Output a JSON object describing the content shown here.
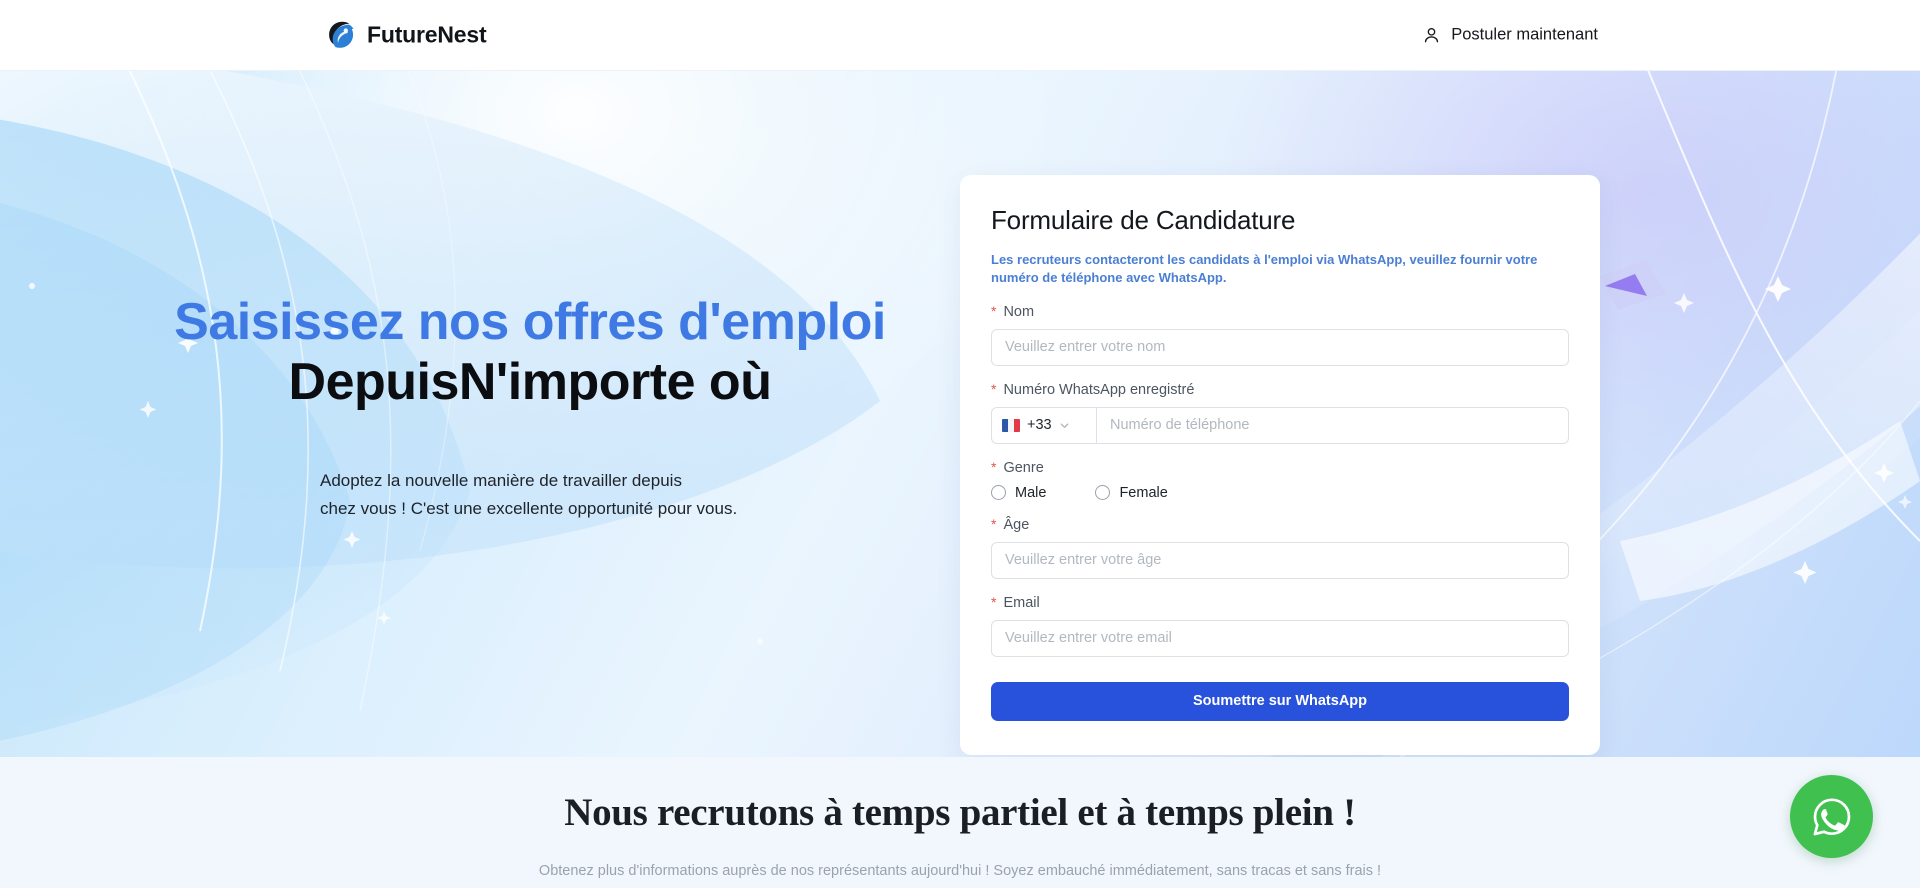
{
  "header": {
    "brand_name": "FutureNest",
    "logo_icon": "leaf-swirl-logo",
    "cta_icon": "user-icon",
    "cta_label": "Postuler maintenant"
  },
  "hero": {
    "headline_blue": "Saisissez nos offres d'emploi",
    "headline_dark": "DepuisN'importe où",
    "sub_line1": "Adoptez la nouvelle manière de travailler depuis",
    "sub_line2": "chez vous ! C'est une excellente opportunité pour vous."
  },
  "form": {
    "title": "Formulaire de Candidature",
    "notice": "Les recruteurs contacteront les candidats à l'emploi via WhatsApp, veuillez fournir votre numéro de téléphone avec WhatsApp.",
    "required_marker": "*",
    "name": {
      "label": "Nom",
      "value": "",
      "placeholder": "Veuillez entrer votre nom"
    },
    "whatsapp": {
      "label": "Numéro WhatsApp enregistré",
      "country_flag": "flag-france",
      "dial_code": "+33",
      "chevron_icon": "chevron-down-icon",
      "value": "",
      "placeholder": "Numéro de téléphone"
    },
    "gender": {
      "label": "Genre",
      "options": [
        {
          "label": "Male",
          "selected": false
        },
        {
          "label": "Female",
          "selected": false
        }
      ]
    },
    "age": {
      "label": "Âge",
      "value": "",
      "placeholder": "Veuillez entrer votre âge"
    },
    "email": {
      "label": "Email",
      "value": "",
      "placeholder": "Veuillez entrer votre email"
    },
    "submit_label": "Soumettre sur WhatsApp"
  },
  "bottom": {
    "title": "Nous recrutons à temps partiel et à temps plein !",
    "subtitle": "Obtenez plus d'informations auprès de nos représentants aujourd'hui ! Soyez embauché immédiatement, sans tracas et sans frais !"
  },
  "floating": {
    "whatsapp_icon": "whatsapp-icon"
  },
  "colors": {
    "brand_blue": "#2852dc",
    "headline_blue": "#3f7ae4",
    "notice_blue": "#4a7fd4",
    "required_red": "#e0564c",
    "whatsapp_green": "#3fc04f",
    "bottom_bg": "#f2f7fd"
  }
}
